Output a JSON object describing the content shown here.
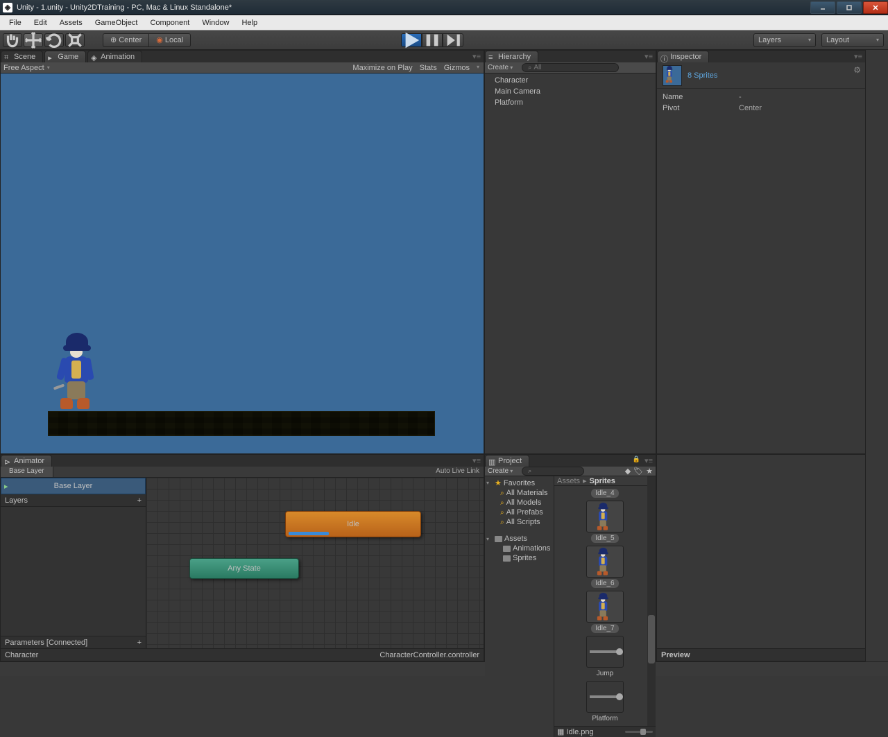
{
  "window": {
    "title": "Unity - 1.unity - Unity2DTraining - PC, Mac & Linux Standalone*"
  },
  "menu": {
    "items": [
      "File",
      "Edit",
      "Assets",
      "GameObject",
      "Component",
      "Window",
      "Help"
    ]
  },
  "toolbar": {
    "pivot_center": "Center",
    "pivot_local": "Local",
    "layers": "Layers",
    "layout": "Layout"
  },
  "tabs": {
    "scene": "Scene",
    "game": "Game",
    "animation": "Animation",
    "hierarchy": "Hierarchy",
    "inspector": "Inspector",
    "animator": "Animator",
    "project": "Project",
    "preview": "Preview"
  },
  "gameview": {
    "aspect": "Free Aspect",
    "maximize": "Maximize on Play",
    "stats": "Stats",
    "gizmos": "Gizmos"
  },
  "hierarchy": {
    "create": "Create",
    "search_placeholder": "All",
    "items": [
      "Character",
      "Main Camera",
      "Platform"
    ]
  },
  "inspector": {
    "selection_title": "8 Sprites",
    "rows": [
      {
        "label": "Name",
        "value": "-"
      },
      {
        "label": "Pivot",
        "value": "Center"
      }
    ]
  },
  "animator": {
    "base_layer_tab": "Base Layer",
    "auto_live_link": "Auto Live Link",
    "layer_name": "Base Layer",
    "layers_label": "Layers",
    "parameters_label": "Parameters [Connected]",
    "states": {
      "idle": "Idle",
      "any": "Any State"
    },
    "footer_left": "Character",
    "footer_right": "CharacterController.controller"
  },
  "project": {
    "create": "Create",
    "favorites_label": "Favorites",
    "favorites": [
      "All Materials",
      "All Models",
      "All Prefabs",
      "All Scripts"
    ],
    "assets_label": "Assets",
    "asset_folders": [
      "Animations",
      "Sprites"
    ],
    "breadcrumb": [
      "Assets",
      "Sprites"
    ],
    "grid_items": [
      {
        "label": "Idle_4",
        "type": "label_only"
      },
      {
        "label": "Idle_5",
        "type": "sprite"
      },
      {
        "label": "Idle_6",
        "type": "sprite"
      },
      {
        "label": "Idle_7",
        "type": "sprite"
      },
      {
        "label": "Jump",
        "type": "anim"
      },
      {
        "label": "Platform",
        "type": "anim"
      }
    ],
    "footer_file": "Idle.png"
  }
}
